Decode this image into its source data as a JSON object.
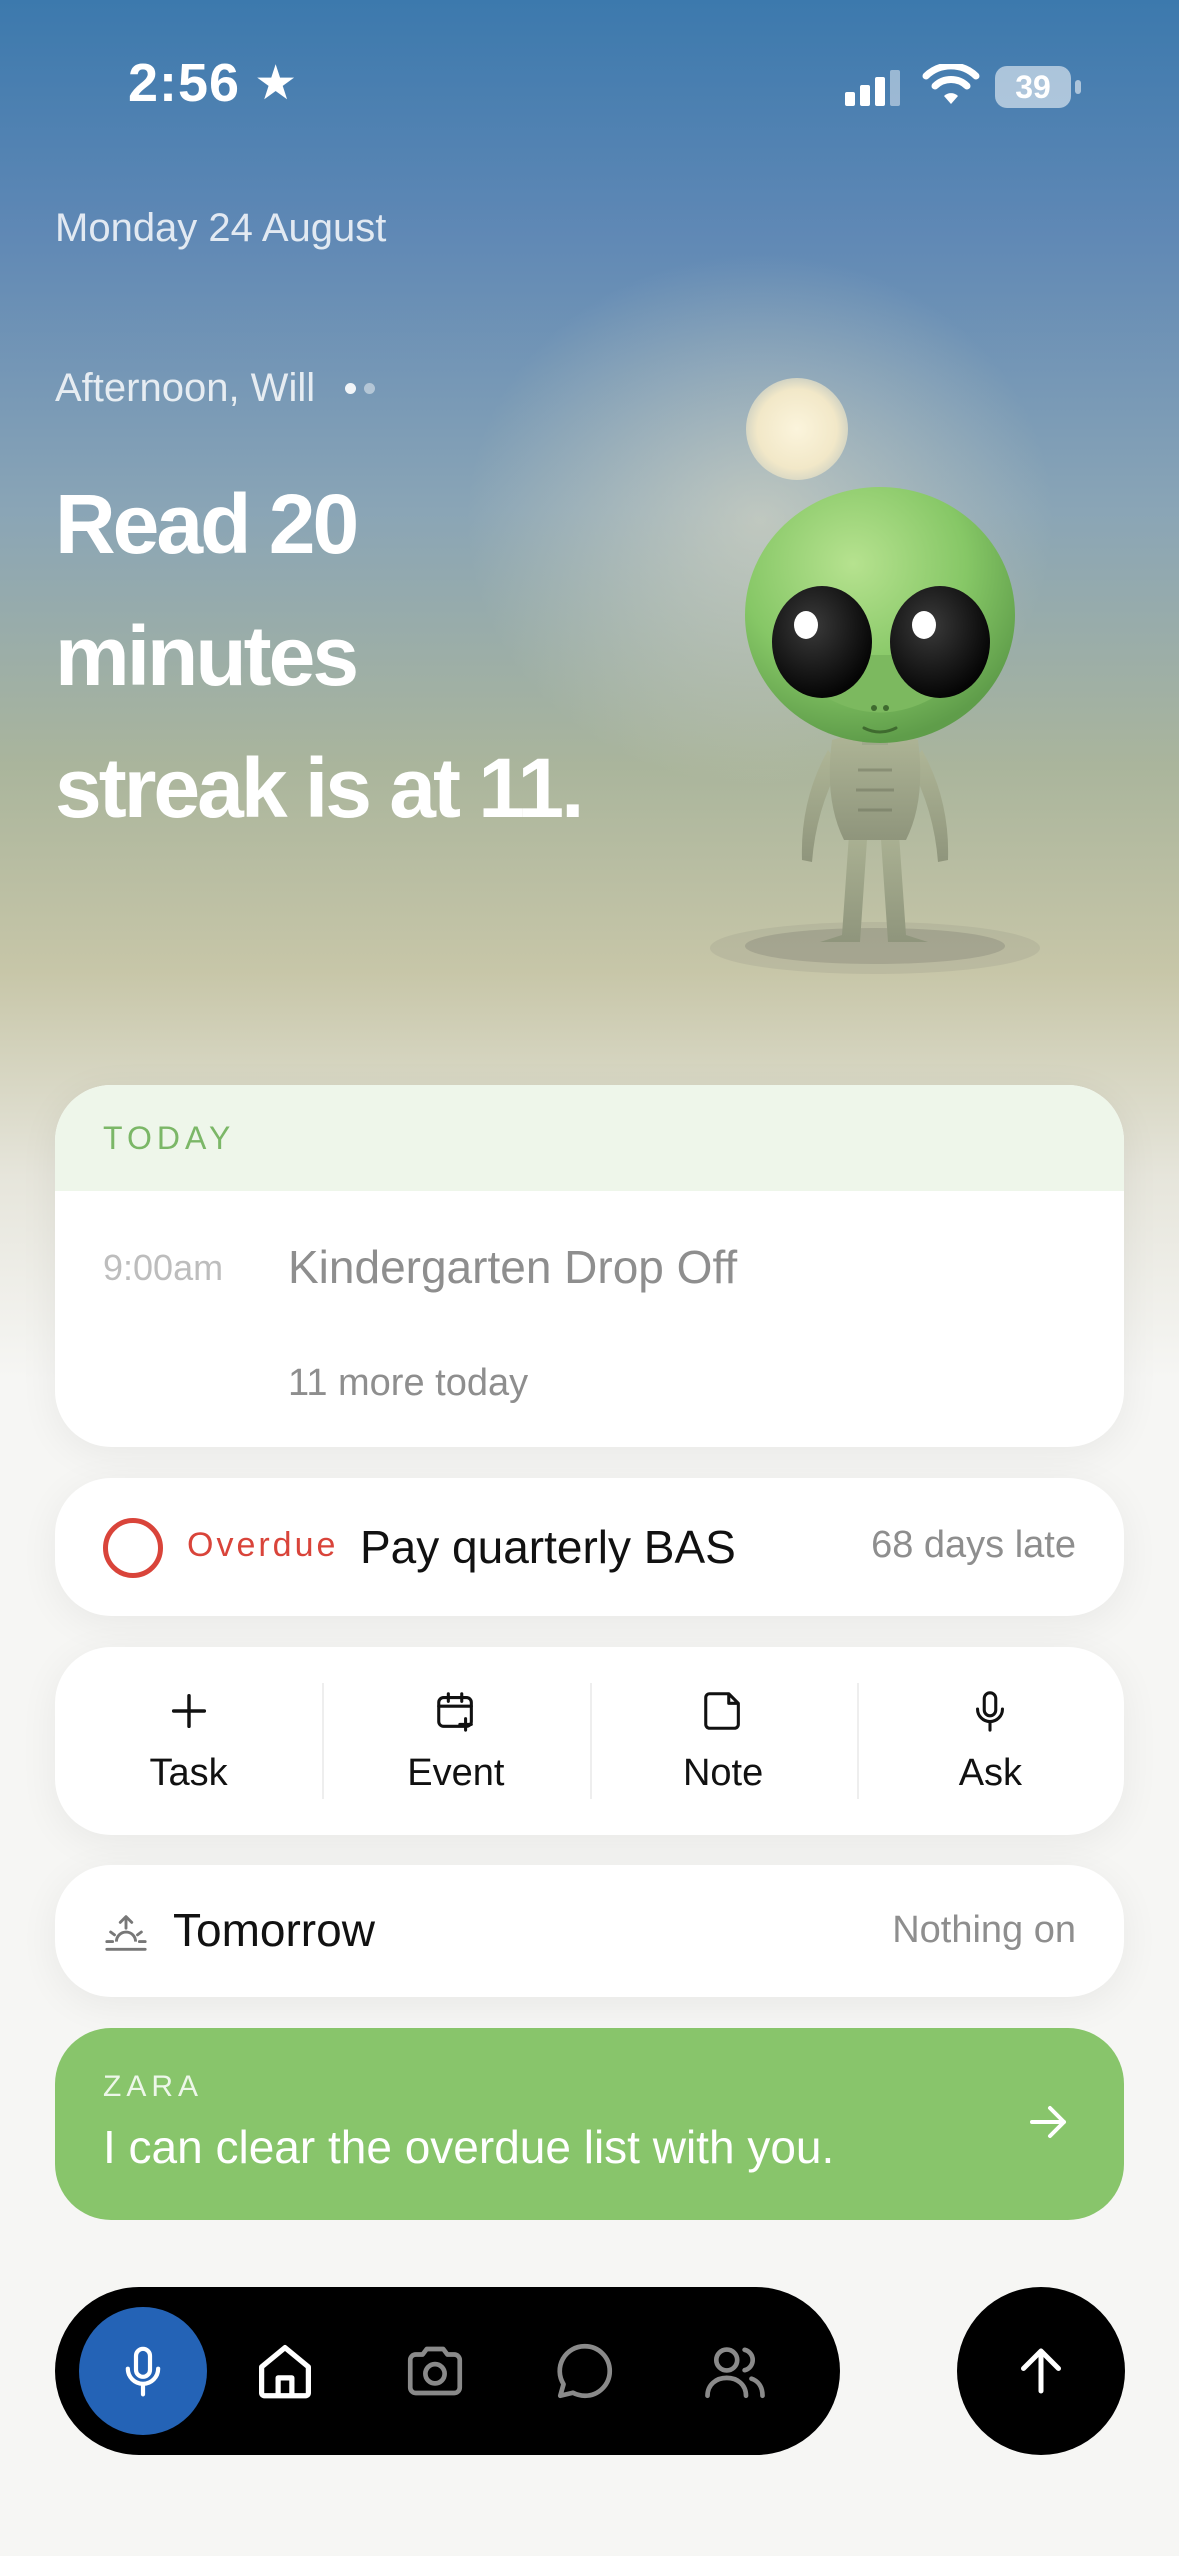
{
  "status_bar": {
    "time": "2:56",
    "battery": "39",
    "icons": [
      "star-icon",
      "signal-icon",
      "wifi-icon",
      "battery-icon"
    ]
  },
  "header": {
    "date": "Monday 24 August",
    "greeting": "Afternoon, Will",
    "headline_line1": "Read 20",
    "headline_line2": "minutes",
    "headline_line3": "streak is at 11."
  },
  "today": {
    "label": "TODAY",
    "event_time": "9:00am",
    "event_title": "Kindergarten Drop Off",
    "more": "11 more today"
  },
  "overdue": {
    "label": "Overdue",
    "title": "Pay quarterly BAS",
    "late": "68 days late"
  },
  "actions": [
    {
      "label": "Task",
      "icon": "plus-icon"
    },
    {
      "label": "Event",
      "icon": "calendar-plus-icon"
    },
    {
      "label": "Note",
      "icon": "note-icon"
    },
    {
      "label": "Ask",
      "icon": "microphone-icon"
    }
  ],
  "tomorrow": {
    "label": "Tomorrow",
    "status": "Nothing on",
    "icon": "sunrise-icon"
  },
  "zara": {
    "name": "ZARA",
    "message": "I can clear the overdue list with you.",
    "icon": "arrow-right-icon"
  },
  "nav": {
    "items": [
      "microphone-icon",
      "home-icon",
      "camera-icon",
      "chat-icon",
      "people-icon"
    ],
    "active": "home-icon",
    "fab_icon": "arrow-up-icon"
  },
  "colors": {
    "accent_green": "#88c56b",
    "overdue_red": "#d9443a",
    "mic_blue": "#2463b6"
  }
}
